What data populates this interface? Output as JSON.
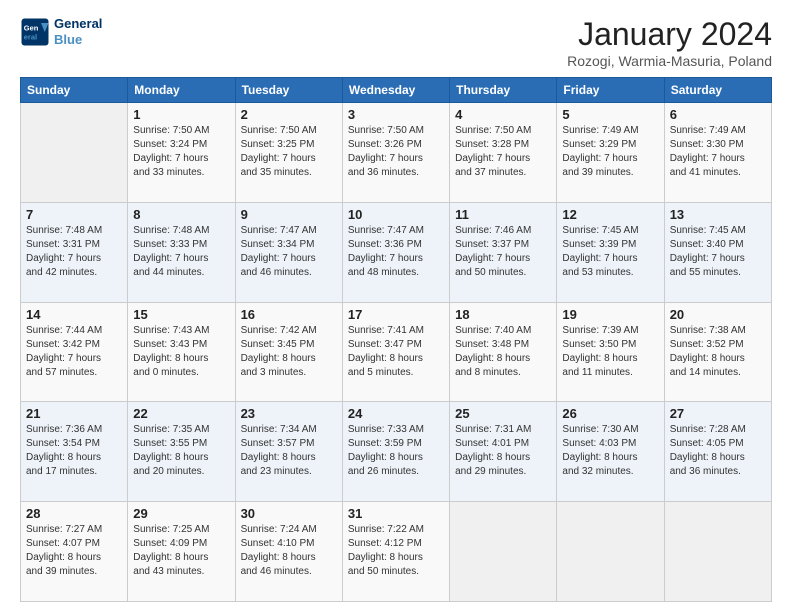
{
  "header": {
    "logo_line1": "General",
    "logo_line2": "Blue",
    "month": "January 2024",
    "location": "Rozogi, Warmia-Masuria, Poland"
  },
  "weekdays": [
    "Sunday",
    "Monday",
    "Tuesday",
    "Wednesday",
    "Thursday",
    "Friday",
    "Saturday"
  ],
  "weeks": [
    [
      {
        "day": "",
        "info": ""
      },
      {
        "day": "1",
        "info": "Sunrise: 7:50 AM\nSunset: 3:24 PM\nDaylight: 7 hours\nand 33 minutes."
      },
      {
        "day": "2",
        "info": "Sunrise: 7:50 AM\nSunset: 3:25 PM\nDaylight: 7 hours\nand 35 minutes."
      },
      {
        "day": "3",
        "info": "Sunrise: 7:50 AM\nSunset: 3:26 PM\nDaylight: 7 hours\nand 36 minutes."
      },
      {
        "day": "4",
        "info": "Sunrise: 7:50 AM\nSunset: 3:28 PM\nDaylight: 7 hours\nand 37 minutes."
      },
      {
        "day": "5",
        "info": "Sunrise: 7:49 AM\nSunset: 3:29 PM\nDaylight: 7 hours\nand 39 minutes."
      },
      {
        "day": "6",
        "info": "Sunrise: 7:49 AM\nSunset: 3:30 PM\nDaylight: 7 hours\nand 41 minutes."
      }
    ],
    [
      {
        "day": "7",
        "info": "Sunrise: 7:48 AM\nSunset: 3:31 PM\nDaylight: 7 hours\nand 42 minutes."
      },
      {
        "day": "8",
        "info": "Sunrise: 7:48 AM\nSunset: 3:33 PM\nDaylight: 7 hours\nand 44 minutes."
      },
      {
        "day": "9",
        "info": "Sunrise: 7:47 AM\nSunset: 3:34 PM\nDaylight: 7 hours\nand 46 minutes."
      },
      {
        "day": "10",
        "info": "Sunrise: 7:47 AM\nSunset: 3:36 PM\nDaylight: 7 hours\nand 48 minutes."
      },
      {
        "day": "11",
        "info": "Sunrise: 7:46 AM\nSunset: 3:37 PM\nDaylight: 7 hours\nand 50 minutes."
      },
      {
        "day": "12",
        "info": "Sunrise: 7:45 AM\nSunset: 3:39 PM\nDaylight: 7 hours\nand 53 minutes."
      },
      {
        "day": "13",
        "info": "Sunrise: 7:45 AM\nSunset: 3:40 PM\nDaylight: 7 hours\nand 55 minutes."
      }
    ],
    [
      {
        "day": "14",
        "info": "Sunrise: 7:44 AM\nSunset: 3:42 PM\nDaylight: 7 hours\nand 57 minutes."
      },
      {
        "day": "15",
        "info": "Sunrise: 7:43 AM\nSunset: 3:43 PM\nDaylight: 8 hours\nand 0 minutes."
      },
      {
        "day": "16",
        "info": "Sunrise: 7:42 AM\nSunset: 3:45 PM\nDaylight: 8 hours\nand 3 minutes."
      },
      {
        "day": "17",
        "info": "Sunrise: 7:41 AM\nSunset: 3:47 PM\nDaylight: 8 hours\nand 5 minutes."
      },
      {
        "day": "18",
        "info": "Sunrise: 7:40 AM\nSunset: 3:48 PM\nDaylight: 8 hours\nand 8 minutes."
      },
      {
        "day": "19",
        "info": "Sunrise: 7:39 AM\nSunset: 3:50 PM\nDaylight: 8 hours\nand 11 minutes."
      },
      {
        "day": "20",
        "info": "Sunrise: 7:38 AM\nSunset: 3:52 PM\nDaylight: 8 hours\nand 14 minutes."
      }
    ],
    [
      {
        "day": "21",
        "info": "Sunrise: 7:36 AM\nSunset: 3:54 PM\nDaylight: 8 hours\nand 17 minutes."
      },
      {
        "day": "22",
        "info": "Sunrise: 7:35 AM\nSunset: 3:55 PM\nDaylight: 8 hours\nand 20 minutes."
      },
      {
        "day": "23",
        "info": "Sunrise: 7:34 AM\nSunset: 3:57 PM\nDaylight: 8 hours\nand 23 minutes."
      },
      {
        "day": "24",
        "info": "Sunrise: 7:33 AM\nSunset: 3:59 PM\nDaylight: 8 hours\nand 26 minutes."
      },
      {
        "day": "25",
        "info": "Sunrise: 7:31 AM\nSunset: 4:01 PM\nDaylight: 8 hours\nand 29 minutes."
      },
      {
        "day": "26",
        "info": "Sunrise: 7:30 AM\nSunset: 4:03 PM\nDaylight: 8 hours\nand 32 minutes."
      },
      {
        "day": "27",
        "info": "Sunrise: 7:28 AM\nSunset: 4:05 PM\nDaylight: 8 hours\nand 36 minutes."
      }
    ],
    [
      {
        "day": "28",
        "info": "Sunrise: 7:27 AM\nSunset: 4:07 PM\nDaylight: 8 hours\nand 39 minutes."
      },
      {
        "day": "29",
        "info": "Sunrise: 7:25 AM\nSunset: 4:09 PM\nDaylight: 8 hours\nand 43 minutes."
      },
      {
        "day": "30",
        "info": "Sunrise: 7:24 AM\nSunset: 4:10 PM\nDaylight: 8 hours\nand 46 minutes."
      },
      {
        "day": "31",
        "info": "Sunrise: 7:22 AM\nSunset: 4:12 PM\nDaylight: 8 hours\nand 50 minutes."
      },
      {
        "day": "",
        "info": ""
      },
      {
        "day": "",
        "info": ""
      },
      {
        "day": "",
        "info": ""
      }
    ]
  ]
}
